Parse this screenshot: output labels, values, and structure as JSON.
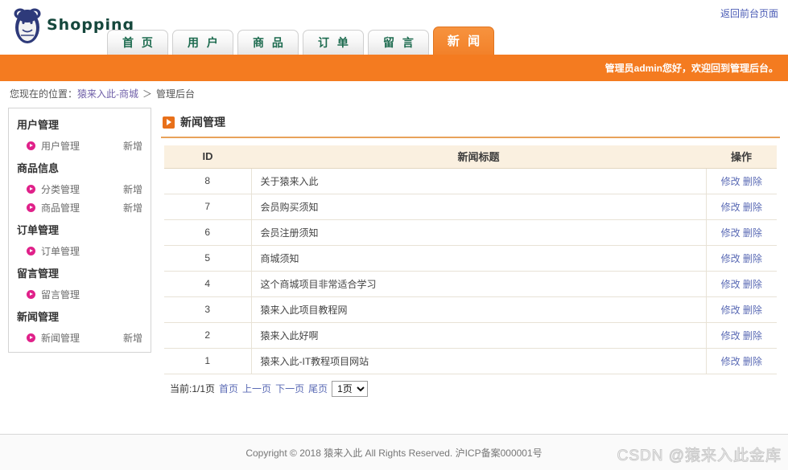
{
  "header": {
    "logo_text": "Shopping",
    "front_link": "返回前台页面",
    "tabs": [
      {
        "label": "首 页",
        "active": false
      },
      {
        "label": "用 户",
        "active": false
      },
      {
        "label": "商 品",
        "active": false
      },
      {
        "label": "订 单",
        "active": false
      },
      {
        "label": "留 言",
        "active": false
      },
      {
        "label": "新 闻",
        "active": true
      }
    ],
    "welcome": "管理员admin您好，欢迎回到管理后台。"
  },
  "breadcrumb": {
    "prefix": "您现在的位置：",
    "link": "猿来入此-商城",
    "sep": "＞",
    "current": "管理后台"
  },
  "sidebar": {
    "groups": [
      {
        "title": "用户管理",
        "items": [
          {
            "label": "用户管理",
            "extra": "新增"
          }
        ]
      },
      {
        "title": "商品信息",
        "items": [
          {
            "label": "分类管理",
            "extra": "新增"
          },
          {
            "label": "商品管理",
            "extra": "新增"
          }
        ]
      },
      {
        "title": "订单管理",
        "items": [
          {
            "label": "订单管理",
            "extra": ""
          }
        ]
      },
      {
        "title": "留言管理",
        "items": [
          {
            "label": "留言管理",
            "extra": ""
          }
        ]
      },
      {
        "title": "新闻管理",
        "items": [
          {
            "label": "新闻管理",
            "extra": "新增"
          }
        ]
      }
    ]
  },
  "panel": {
    "title": "新闻管理"
  },
  "table": {
    "columns": [
      "ID",
      "新闻标题",
      "操作"
    ],
    "rows": [
      {
        "id": "8",
        "title": "关于猿来入此",
        "edit": "修改",
        "delete": "删除"
      },
      {
        "id": "7",
        "title": "会员购买须知",
        "edit": "修改",
        "delete": "删除"
      },
      {
        "id": "6",
        "title": "会员注册须知",
        "edit": "修改",
        "delete": "删除"
      },
      {
        "id": "5",
        "title": "商城须知",
        "edit": "修改",
        "delete": "删除"
      },
      {
        "id": "4",
        "title": "这个商城项目非常适合学习",
        "edit": "修改",
        "delete": "删除"
      },
      {
        "id": "3",
        "title": "猿来入此项目教程网",
        "edit": "修改",
        "delete": "删除"
      },
      {
        "id": "2",
        "title": "猿来入此好啊",
        "edit": "修改",
        "delete": "删除"
      },
      {
        "id": "1",
        "title": "猿来入此-IT教程项目网站",
        "edit": "修改",
        "delete": "删除"
      }
    ]
  },
  "pager": {
    "current_text": "当前:1/1页",
    "first": "首页",
    "prev": "上一页",
    "next": "下一页",
    "last": "尾页",
    "selected_page": "1页",
    "options": [
      "1页"
    ]
  },
  "footer": {
    "copyright": "Copyright © 2018 猿来入此 All Rights Reserved. 沪ICP备案000001号",
    "watermark": "CSDN @猿来入此金库"
  },
  "colors": {
    "orange": "#f47b20",
    "tab_text": "#1d6b4f",
    "link": "#5b6bb5",
    "bullet": "#e0218a",
    "table_header_bg": "#faf0e0"
  }
}
